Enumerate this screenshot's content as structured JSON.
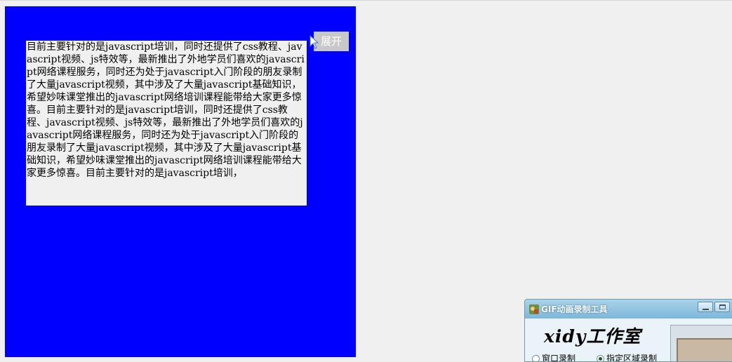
{
  "content": {
    "paragraph": "目前主要针对的是javascript培训，同时还提供了css教程、javascript视频、js特效等，最新推出了外地学员们喜欢的javascript网络课程服务，同时还为处于javascript入门阶段的朋友录制了大量javascript视频，其中涉及了大量javascript基础知识，希望妙味课堂推出的javascript网络培训课程能带给大家更多惊喜。目前主要针对的是javascript培训，同时还提供了css教程、javascript视频、js特效等，最新推出了外地学员们喜欢的javascript网络课程服务，同时还为处于javascript入门阶段的朋友录制了大量javascript视频，其中涉及了大量javascript基础知识，希望妙味课堂推出的javascript网络培训课程能带给大家更多惊喜。目前主要针对的是javascript培训，"
  },
  "expand_button": {
    "label": "展开"
  },
  "gif_recorder": {
    "title": "GIF动画录制工具",
    "brand": "xidy工作室",
    "radio_options": [
      {
        "label": "窗口录制",
        "checked": false
      },
      {
        "label": "指定区域录制",
        "checked": true
      }
    ]
  },
  "colors": {
    "panel": "#0000ff",
    "text_box_bg": "#f0f0f0",
    "button_bg": "#c8c8c8",
    "button_text": "#ffffff"
  }
}
